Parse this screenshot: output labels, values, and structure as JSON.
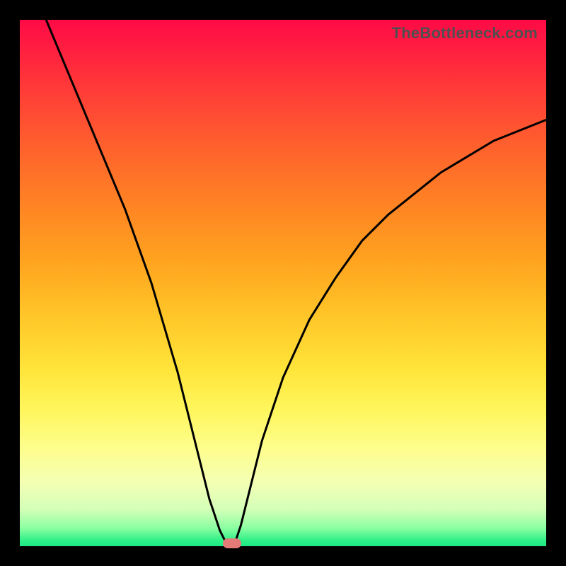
{
  "watermark": "TheBottleneck.com",
  "chart_data": {
    "type": "line",
    "title": "",
    "xlabel": "",
    "ylabel": "",
    "xlim": [
      0,
      100
    ],
    "ylim": [
      0,
      100
    ],
    "grid": false,
    "legend": false,
    "series": [
      {
        "name": "bottleneck-curve",
        "x": [
          5,
          10,
          15,
          20,
          25,
          30,
          32,
          34,
          36,
          38,
          39,
          39.5,
          40,
          41,
          42,
          43,
          46,
          50,
          55,
          60,
          65,
          70,
          75,
          80,
          85,
          90,
          95,
          100
        ],
        "y": [
          100,
          88,
          76,
          64,
          50,
          33,
          25,
          17,
          9,
          3,
          1,
          0.5,
          0.5,
          1,
          4,
          8,
          20,
          32,
          43,
          51,
          58,
          63,
          67,
          71,
          74,
          77,
          79,
          81
        ]
      }
    ],
    "marker": {
      "x_percent": 40.3,
      "y_percent": 0.5,
      "color": "#e47a78"
    },
    "background_gradient": {
      "top": "#ff0a46",
      "mid": "#ffd93a",
      "bottom": "#1ee884"
    }
  }
}
